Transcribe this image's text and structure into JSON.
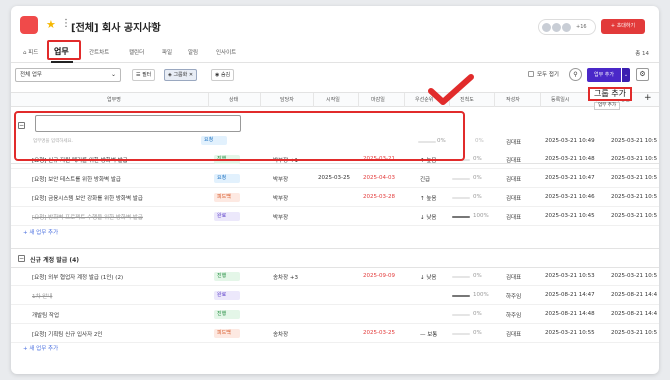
{
  "header": {
    "title": "[전체] 회사 공지사항",
    "avatar_more": "+16",
    "invite_label": "초대하기"
  },
  "tabs": [
    {
      "label": "피드"
    },
    {
      "label": "업무"
    },
    {
      "label": "간트차트"
    },
    {
      "label": "캘린더"
    },
    {
      "label": "파일"
    },
    {
      "label": "알림"
    },
    {
      "label": "인사이트"
    }
  ],
  "total_label": "총 14",
  "toolbar": {
    "select_value": "전체 업무",
    "filter_label": "필터",
    "group_label": "그룹화",
    "hide_label": "숨김",
    "fold_all_label": "모두 접기",
    "add_task_label": "업무 추가"
  },
  "columns": [
    "업무명",
    "상태",
    "담당자",
    "시작일",
    "마감일",
    "우선순위",
    "진척도",
    "작성자",
    "등록일시",
    "수정일"
  ],
  "new_task": {
    "placeholder": "업무명을 입력하세요.",
    "status": "요청",
    "progress": "0%",
    "author": "김대표",
    "created": "2025-03-21 10:49",
    "modified": "2025-03-21 10:5"
  },
  "group1_rows": [
    {
      "name": "[요청] 신규 지원 폐기를 위한 방화벽 발급",
      "status": "진행",
      "status_type": "prog",
      "assignee": "박부장 +1",
      "start": "",
      "due": "2025-03-21",
      "priority": "↑ 높음",
      "progress": 0,
      "progress_label": "0%",
      "author": "김대표",
      "created": "2025-03-21 10:48",
      "modified": "2025-03-21 10:5",
      "strike": false
    },
    {
      "name": "[요청] 보안 테스트를 위한 방화벽 발급",
      "status": "요청",
      "status_type": "req",
      "assignee": "박부장",
      "start": "2025-03-25",
      "due": "2025-04-03",
      "priority": "긴급",
      "progress": 0,
      "progress_label": "0%",
      "author": "김대표",
      "created": "2025-03-21 10:47",
      "modified": "2025-03-21 10:5",
      "strike": false
    },
    {
      "name": "[요청] 금융시스템 보안 강화를 위한 방화벽 발급",
      "status": "피드백",
      "status_type": "fb",
      "assignee": "박부장",
      "start": "",
      "due": "2025-03-28",
      "priority": "↑ 높음",
      "progress": 0,
      "progress_label": "0%",
      "author": "김대표",
      "created": "2025-03-21 10:46",
      "modified": "2025-03-21 10:5",
      "strike": false
    },
    {
      "name": "[요청] 방화벽 프로젝트 수행을 위한 방화벽 발급",
      "status": "완료",
      "status_type": "done",
      "assignee": "박부장",
      "start": "",
      "due": "",
      "priority": "↓ 낮음",
      "progress": 100,
      "progress_label": "100%",
      "author": "김대표",
      "created": "2025-03-21 10:45",
      "modified": "2025-03-21 10:5",
      "strike": true
    }
  ],
  "add_row_label": "+ 새 업무 추가",
  "group2": {
    "name": "신규 계정 발급 (4)"
  },
  "group2_rows": [
    {
      "name": "[요청] 외부 협업자 계정 발급 (1인) (2)",
      "status": "진행",
      "status_type": "prog",
      "assignee": "송차장 +3",
      "start": "",
      "due": "2025-09-09",
      "priority": "↓ 낮음",
      "progress": 0,
      "progress_label": "0%",
      "author": "김대표",
      "created": "2025-03-21 10:53",
      "modified": "2025-03-21 10:5",
      "strike": false
    },
    {
      "name": "1차 안내",
      "status": "완료",
      "status_type": "done",
      "assignee": "",
      "start": "",
      "due": "",
      "priority": "",
      "progress": 100,
      "progress_label": "100%",
      "author": "하주임",
      "created": "2025-08-21 14:47",
      "modified": "2025-08-21 14:4",
      "strike": true
    },
    {
      "name": "개발팀 작업",
      "status": "진행",
      "status_type": "prog",
      "assignee": "",
      "start": "",
      "due": "",
      "priority": "",
      "progress": 0,
      "progress_label": "0%",
      "author": "하주임",
      "created": "2025-08-21 14:48",
      "modified": "2025-08-21 14:4",
      "strike": false
    },
    {
      "name": "[요청] 기획팀 신규 입사자 2인",
      "status": "피드백",
      "status_type": "fb",
      "assignee": "송차장",
      "start": "",
      "due": "2025-03-25",
      "priority": "— 보통",
      "progress": 0,
      "progress_label": "0%",
      "author": "김대표",
      "created": "2025-03-21 10:55",
      "modified": "2025-03-21 10:5",
      "strike": false
    }
  ],
  "tooltip": {
    "big": "그룹 추가",
    "small": "업무 추가"
  },
  "colors": {
    "accent": "#4a28c8",
    "brand": "#f04a4a",
    "highlight": "#e12b2b"
  }
}
